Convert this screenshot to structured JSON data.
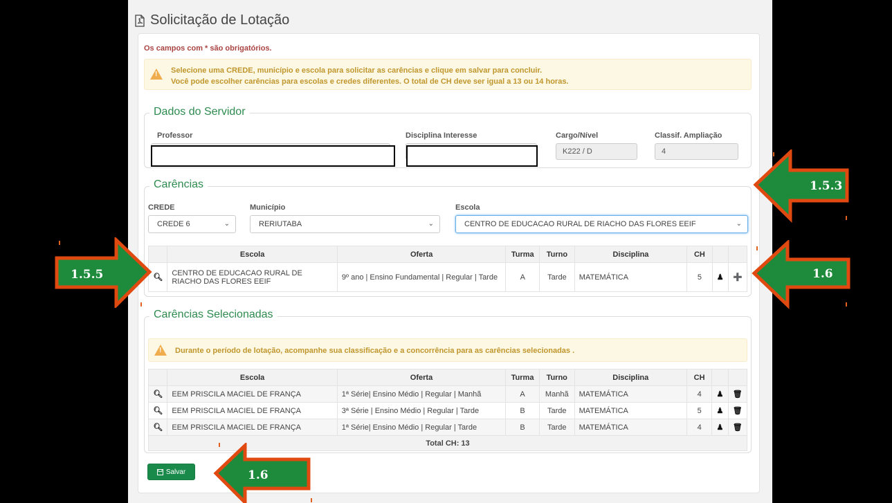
{
  "page": {
    "title": "Solicitação de Lotação",
    "required_note": "Os campos com * são obrigatórios."
  },
  "alert_top": {
    "line1": "Selecione uma CREDE, município e escola para solicitar as carências e clique em salvar para concluir.",
    "line2": "Você pode escolher carências para escolas e credes diferentes. O total de CH deve ser igual a 13 ou 14 horas."
  },
  "servidor": {
    "legend": "Dados do Servidor",
    "professor_label": "Professor",
    "disciplina_label": "Disciplina Interesse",
    "cargo_label": "Cargo/Nível",
    "cargo_value": "K222 / D",
    "classif_label": "Classif. Ampliação",
    "classif_value": "4"
  },
  "carencias": {
    "legend": "Carências",
    "crede_label": "CREDE",
    "crede_value": "CREDE 6",
    "municipio_label": "Município",
    "municipio_value": "RERIUTABA",
    "escola_label": "Escola",
    "escola_value": "CENTRO DE EDUCACAO RURAL DE RIACHO DAS FLORES EEIF",
    "columns": [
      "Escola",
      "Oferta",
      "Turma",
      "Turno",
      "Disciplina",
      "CH"
    ],
    "rows": [
      {
        "escola": "CENTRO DE EDUCACAO RURAL DE RIACHO DAS FLORES EEIF",
        "oferta": "9º ano | Ensino Fundamental | Regular | Tarde",
        "turma": "A",
        "turno": "Tarde",
        "disciplina": "MATEMÁTICA",
        "ch": "5"
      }
    ]
  },
  "selecionadas": {
    "legend": "Carências Selecionadas",
    "alert": "Durante o período de lotação, acompanhe sua classificação e a concorrência para as carências selecionadas .",
    "columns": [
      "Escola",
      "Oferta",
      "Turma",
      "Turno",
      "Disciplina",
      "CH"
    ],
    "rows": [
      {
        "escola": "EEM PRISCILA MACIEL DE FRANÇA",
        "oferta": "1ª Série| Ensino Médio | Regular | Manhã",
        "turma": "A",
        "turno": "Manhã",
        "disciplina": "MATEMÁTICA",
        "ch": "4"
      },
      {
        "escola": "EEM PRISCILA MACIEL DE FRANÇA",
        "oferta": "3ª Série | Ensino Médio | Regular | Tarde",
        "turma": "B",
        "turno": "Tarde",
        "disciplina": "MATEMÁTICA",
        "ch": "5"
      },
      {
        "escola": "EEM PRISCILA MACIEL DE FRANÇA",
        "oferta": "1ª Série| Ensino Médio | Regular | Tarde",
        "turma": "B",
        "turno": "Tarde",
        "disciplina": "MATEMÁTICA",
        "ch": "4"
      }
    ],
    "total": "Total CH: 13"
  },
  "actions": {
    "save_label": "Salvar"
  },
  "annotations": {
    "a1": "1.5.3",
    "a2": "1.5.5",
    "a3": "1.6",
    "a4": "1.6"
  },
  "colors": {
    "accent": "#2e8b4f",
    "save_button": "#1a8a4b",
    "arrow_fill": "#1e8a3c",
    "arrow_border": "#e04a10"
  }
}
